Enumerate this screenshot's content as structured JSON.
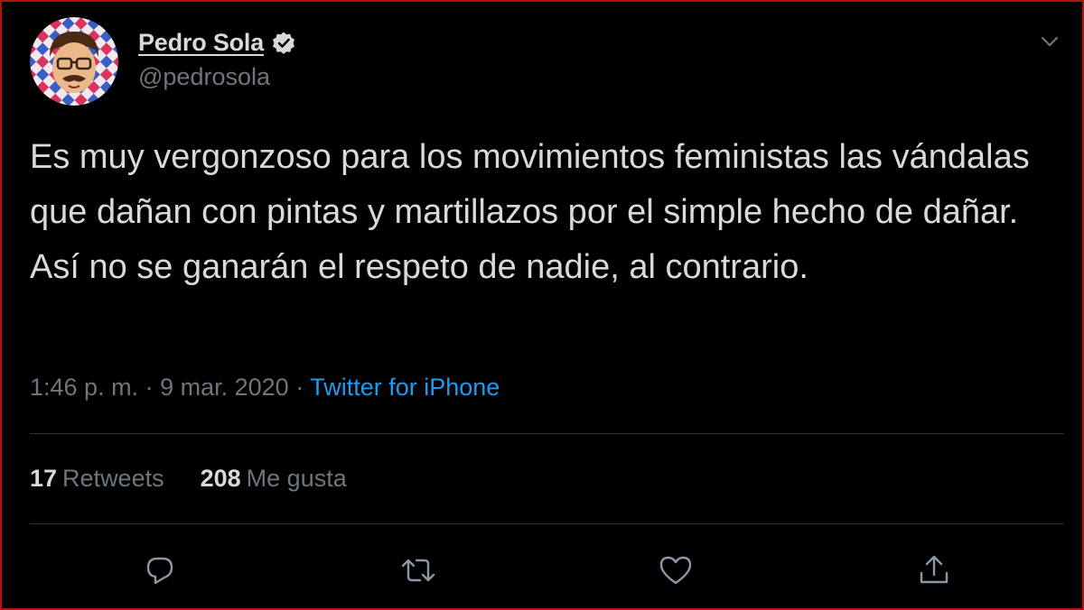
{
  "author": {
    "name": "Pedro Sola",
    "handle": "@pedrosola",
    "verified": true
  },
  "tweet": {
    "text": "Es muy vergonzoso para los movimientos feministas las vándalas que dañan con pintas y martillazos por el simple hecho de dañar. Así no se ganarán el respeto de nadie, al contrario.",
    "time": "1:46 p. m.",
    "date": "9 mar. 2020",
    "separator": "·",
    "source": "Twitter for iPhone"
  },
  "stats": {
    "retweets_count": "17",
    "retweets_label": "Retweets",
    "likes_count": "208",
    "likes_label": "Me gusta"
  },
  "actions": {
    "icons": [
      "reply-icon",
      "retweet-icon",
      "like-icon",
      "share-icon"
    ]
  },
  "colors": {
    "background": "#000000",
    "text": "#d9d9d9",
    "secondary_text": "#6e767d",
    "link": "#1d9bf0",
    "divider": "#2f3336",
    "frame_border": "#b3120f"
  }
}
